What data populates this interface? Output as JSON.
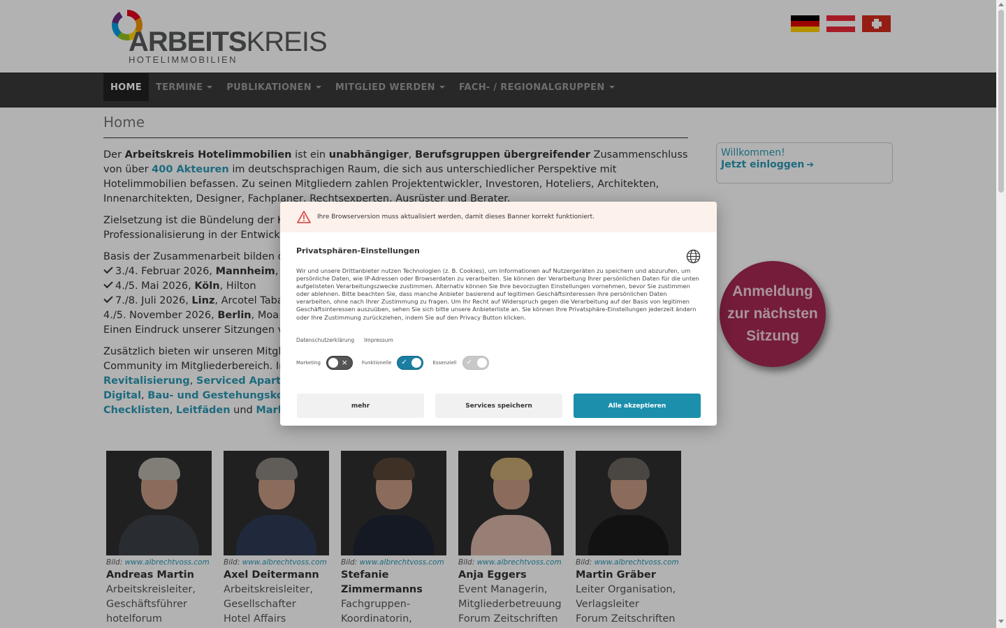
{
  "logo": {
    "word_bold": "ARBEITS",
    "word_light": "KREIS",
    "subtitle": "HOTELIMMOBILIEN"
  },
  "nav": {
    "items": [
      {
        "label": "HOME",
        "active": true,
        "dropdown": false
      },
      {
        "label": "TERMINE",
        "dropdown": true
      },
      {
        "label": "PUBLIKATIONEN",
        "dropdown": true
      },
      {
        "label": "MITGLIED WERDEN",
        "dropdown": true
      },
      {
        "label": "FACH- / REGIONALGRUPPEN",
        "dropdown": true
      }
    ]
  },
  "page": {
    "title": "Home"
  },
  "intro": {
    "t1": "Der ",
    "b1": "Arbeitskreis Hotelimmobilien",
    "t2": " ist ein ",
    "b2": "unabhängiger",
    "t3": ", ",
    "b3": "Berufsgruppen übergreifender",
    "t4": " Zusammenschluss von über ",
    "l1": "400 Akteuren",
    "t5": " im deutschsprachigen Raum, die sich aus unterschiedlicher Perspektive mit Hotelimmobilien befassen. Zu seinen Mitgliedern zahlen Projektentwickler, Investoren, Hoteliers, Architekten, Innenarchitekten, Designer, Fachplaner, Rechtsexperten, Ausrüster und Berater."
  },
  "goal": {
    "line1": "Zielsetzung ist die Bündelung der Ko",
    "line2": "Professionalisierung in der Entwicklu"
  },
  "meetings": {
    "intro": "Basis der Zusammenarbeit bilden di",
    "items": [
      {
        "check": true,
        "date": "3./4. Februar 2026, ",
        "city": "Mannheim",
        "venue": ", D"
      },
      {
        "check": true,
        "date": "4./5. Mai 2026, ",
        "city": "Köln",
        "venue": ", Hilton"
      },
      {
        "check": true,
        "date": "7./8. Juli 2026, ",
        "city": "Linz",
        "venue": ", Arcotel Taba"
      },
      {
        "check": false,
        "date": "4./5. November 2026, ",
        "city": "Berlin",
        "venue": ", Moa"
      }
    ],
    "outro": "Einen Eindruck unserer Sitzungen ve"
  },
  "extra": {
    "line1": "Zusätzlich bieten wir unseren Mitglie",
    "line2": "Community im Mitgliederbereich. In",
    "l1": "Revitalisierung",
    "s1": ", ",
    "l2": "Serviced Apartm",
    "l3": "Digital",
    "s2": ", ",
    "l4": "Bau- und Gestehungskos",
    "l5": "Checklisten",
    "s3": ", ",
    "l6": "Leitfäden",
    "s4": " und ",
    "l7": "Markt"
  },
  "sidebar": {
    "welcome": "Willkommen!",
    "login": "Jetzt einloggen",
    "signup": "Anmeldung zur nächsten Sitzung"
  },
  "team": [
    {
      "credit_prefix": "Bild: ",
      "credit_link": "www.albrechtvoss.com",
      "name": "Andreas Martin",
      "role1": "Arbeitskreisleiter,",
      "role2": "Geschäftsführer",
      "role3": "hotelforum"
    },
    {
      "credit_prefix": "Bild: ",
      "credit_link": "www.albrechtvoss.com",
      "name": "Axel Deitermann",
      "role1": "Arbeitskreisleiter,",
      "role2": "Gesellschafter",
      "role3": "Hotel Affairs"
    },
    {
      "credit_prefix": "Bild: ",
      "credit_link": "www.albrechtvoss.com",
      "name": "Stefanie Zimmermanns",
      "role1": "Fachgruppen-",
      "role2": "Koordinatorin,",
      "role3": ""
    },
    {
      "credit_prefix": "Bild: ",
      "credit_link": "www.albrechtvoss.com",
      "name": "Anja Eggers",
      "role1": "Event Managerin,",
      "role2": "Mitgliederbetreuung",
      "role3": "Forum Zeitschriften"
    },
    {
      "credit_prefix": "Bild: ",
      "credit_link": "www.albrechtvoss.com",
      "name": "Martin Gräber",
      "role1": "Leiter Organisation,",
      "role2": "Verlagsleiter",
      "role3": "Forum Zeitschriften"
    }
  ],
  "consent": {
    "warning": "Ihre Browserversion muss aktualisiert werden, damit dieses Banner korrekt funktioniert.",
    "title": "Privatsphären-Einstellungen",
    "text": "Wir und unsere Drittanbieter nutzen Technologien (z. B. Cookies), um Informationen auf Nutzergeräten zu speichern und abzurufen, um persönliche Daten, wie IP-Adressen oder Browserdaten zu verarbeiten. Sie können der Verarbeitung Ihrer persönlichen Daten für die unten aufgelisteten Verarbeitungszwecke zustimmen. Alternativ können Sie Ihre bevorzugten Einstellungen vornehmen, bevor Sie zustimmen oder ablehnen. Bitte beachten Sie, dass manche Anbieter basierend auf legitimen Geschäftsinteressen Ihre persönlichen Daten verarbeiten, ohne nach Ihrer Zustimmung zu fragen. Um Ihr Recht auf Widerspruch gegen die Verarbeitung auf der Basis von legitimen Geschäftsinteressen auszuüben, sehen Sie sich bitte unsere Anbieterliste an. Sie können Ihre Privatsphäre-Einstellungen jederzeit ändern oder Ihre Zustimmung zurückziehen, indem Sie auf den Privacy Button klicken.",
    "link_privacy": "Datenschutzerklärung",
    "link_imprint": "Impressum",
    "toggles": [
      {
        "label": "Marketing",
        "state": "off"
      },
      {
        "label": "Funktionelle",
        "state": "on"
      },
      {
        "label": "Essenziell",
        "state": "disabled"
      }
    ],
    "btn_more": "mehr",
    "btn_save": "Services speichern",
    "btn_accept": "Alle akzeptieren"
  }
}
